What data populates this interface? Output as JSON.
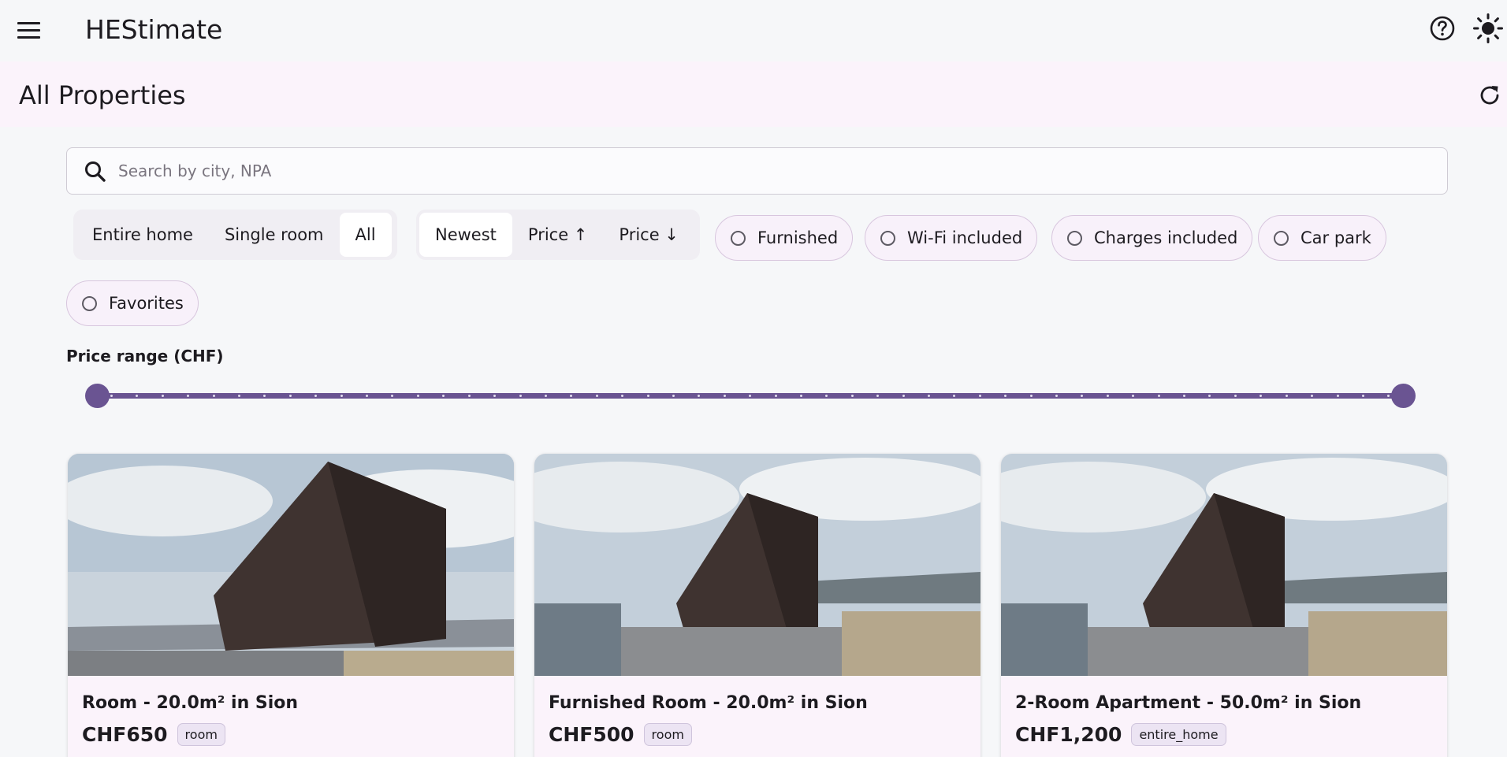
{
  "app": {
    "title": "HEStimate"
  },
  "page": {
    "title": "All Properties"
  },
  "search": {
    "placeholder": "Search by city, NPA",
    "value": ""
  },
  "type_filter": {
    "options": [
      {
        "label": "Entire home",
        "selected": false
      },
      {
        "label": "Single room",
        "selected": false
      },
      {
        "label": "All",
        "selected": true
      }
    ]
  },
  "sort": {
    "options": [
      {
        "label": "Newest",
        "selected": true
      },
      {
        "label": "Price ↑",
        "selected": false
      },
      {
        "label": "Price ↓",
        "selected": false
      }
    ]
  },
  "amenity_filters": [
    {
      "label": "Furnished",
      "checked": false
    },
    {
      "label": "Wi-Fi included",
      "checked": false
    },
    {
      "label": "Charges included",
      "checked": false
    },
    {
      "label": "Car park",
      "checked": false
    },
    {
      "label": "Favorites",
      "checked": false
    }
  ],
  "price_range": {
    "label": "Price range (CHF)",
    "lower_fraction": 0.0,
    "upper_fraction": 1.0
  },
  "listings": [
    {
      "title": "Room - 20.0m² in Sion",
      "price": "CHF650",
      "type": "room"
    },
    {
      "title": "Furnished Room - 20.0m² in Sion",
      "price": "CHF500",
      "type": "room"
    },
    {
      "title": "2-Room Apartment - 50.0m² in Sion",
      "price": "CHF1,200",
      "type": "entire_home"
    }
  ],
  "icons": {
    "menu": "menu-icon",
    "help": "help-circle-icon",
    "theme": "sun-icon",
    "refresh": "refresh-icon",
    "search": "search-icon"
  },
  "colors": {
    "accent": "#6a5492",
    "subbar": "#fbf3fb",
    "background": "#f6f7f9"
  }
}
